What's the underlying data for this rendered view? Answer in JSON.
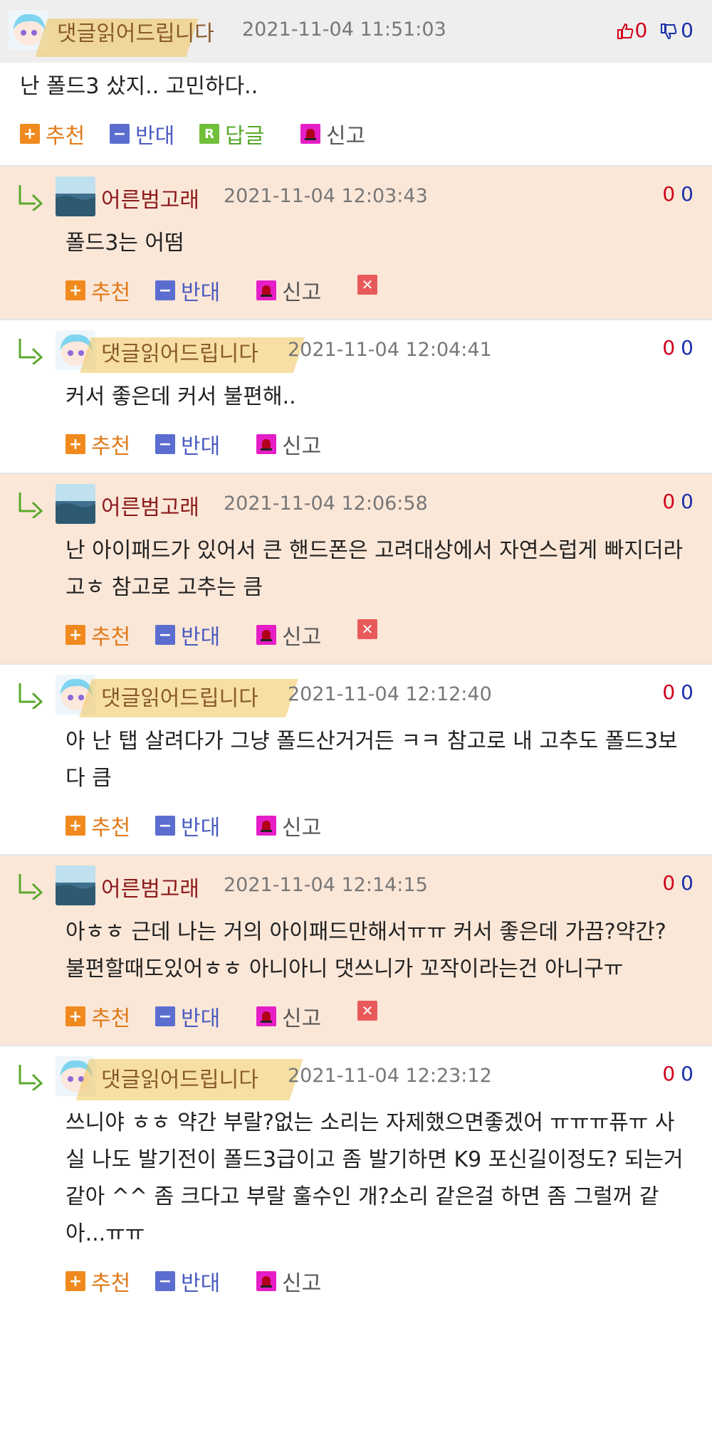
{
  "comments": [
    {
      "nick": "댓글읽어드립니다",
      "date": "2021-11-04 11:51:03",
      "up": "0",
      "down": "0",
      "text": "난 폴드3 샀지.. 고민하다..",
      "actions": {
        "recommend": "추천",
        "oppose": "반대",
        "reply": "답글",
        "report": "신고"
      }
    },
    {
      "nick": "어른범고래",
      "date": "2021-11-04 12:03:43",
      "up": "0",
      "down": "0",
      "text": "폴드3는 어떰",
      "actions": {
        "recommend": "추천",
        "oppose": "반대",
        "report": "신고"
      }
    },
    {
      "nick": "댓글읽어드립니다",
      "date": "2021-11-04 12:04:41",
      "up": "0",
      "down": "0",
      "text": "커서 좋은데 커서 불편해..",
      "actions": {
        "recommend": "추천",
        "oppose": "반대",
        "report": "신고"
      }
    },
    {
      "nick": "어른범고래",
      "date": "2021-11-04 12:06:58",
      "up": "0",
      "down": "0",
      "text": "난 아이패드가 있어서 큰 핸드폰은 고려대상에서 자연스럽게 빠지더라고ㅎ 참고로 고추는 큼",
      "actions": {
        "recommend": "추천",
        "oppose": "반대",
        "report": "신고"
      }
    },
    {
      "nick": "댓글읽어드립니다",
      "date": "2021-11-04 12:12:40",
      "up": "0",
      "down": "0",
      "text": "아 난 탭 살려다가 그냥 폴드산거거든 ㅋㅋ 참고로 내 고추도 폴드3보다 큼",
      "actions": {
        "recommend": "추천",
        "oppose": "반대",
        "report": "신고"
      }
    },
    {
      "nick": "어른범고래",
      "date": "2021-11-04 12:14:15",
      "up": "0",
      "down": "0",
      "text": "아ㅎㅎ 근데 나는 거의 아이패드만해서ㅠㅠ 커서 좋은데 가끔?약간? 불편할때도있어ㅎㅎ 아니아니 댓쓰니가 꼬작이라는건 아니구ㅠ",
      "actions": {
        "recommend": "추천",
        "oppose": "반대",
        "report": "신고"
      }
    },
    {
      "nick": "댓글읽어드립니다",
      "date": "2021-11-04 12:23:12",
      "up": "0",
      "down": "0",
      "text": "쓰니야 ㅎㅎ 약간 부랄?없는 소리는 자제했으면좋겠어 ㅠㅠㅠ퓨ㅠ 사실 나도 발기전이 폴드3급이고 좀 발기하면 K9 포신길이정도? 되는거 같아 ^^ 좀 크다고 부랄 훌수인 개?소리 같은걸 하면 좀 그럴꺼 같아...ㅠㅠ",
      "actions": {
        "recommend": "추천",
        "oppose": "반대",
        "report": "신고"
      }
    }
  ]
}
